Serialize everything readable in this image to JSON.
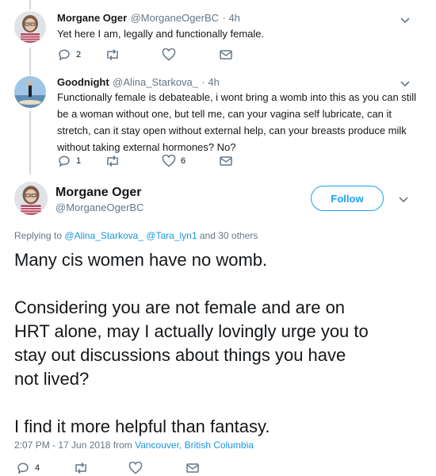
{
  "tweet1": {
    "name": "Morgane Oger",
    "handle": "@MorganeOgerBC",
    "time": "· 4h",
    "text": "Yet here I am, legally and functionally female.",
    "replies": "2",
    "likes": ""
  },
  "tweet2": {
    "name": "Goodnight",
    "handle": "@Alina_Starkova_",
    "time": "· 4h",
    "lines": [
      "Functionally female is debateable, i wont bring a womb into this as you can still",
      "be a woman without one, but tell me, can your vagina self lubricate, can it",
      "stretch, can it stay open without external help, can your breasts produce milk",
      "without taking external hormones? No?"
    ],
    "replies": "1",
    "likes": "6"
  },
  "main": {
    "name": "Morgane Oger",
    "handle": "@MorganeOgerBC",
    "follow_label": "Follow",
    "replying_prefix": "Replying to",
    "replying_user1": "@Alina_Starkova_",
    "replying_user2": "@Tara_lyn1",
    "replying_suffix": "and 30 others",
    "lines": [
      "Many cis women have no womb.",
      "",
      "Considering you are not female and are on",
      "HRT alone, may I actually lovingly urge you to",
      "stay out discussions about things you have",
      "not lived?",
      "",
      "I find it more helpful than fantasy."
    ],
    "timestamp": "2:07 PM - 17 Jun 2018 from",
    "location": "Vancouver, British Columbia",
    "replies": "4"
  },
  "icons": {
    "reply": "reply-icon",
    "retweet": "retweet-icon",
    "like": "heart-icon",
    "dm": "mail-icon",
    "more": "chevron-down-icon"
  },
  "colors": {
    "link": "#1b95e0",
    "secondary_text": "#657786",
    "follow": "#1da1f2",
    "thread_line": "#cfd9de"
  }
}
